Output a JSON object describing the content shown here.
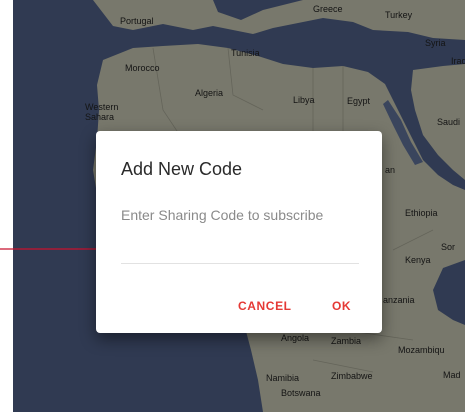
{
  "map": {
    "labels": {
      "portugal": "Portugal",
      "greece": "Greece",
      "turkey": "Turkey",
      "tunisia": "Tunisia",
      "syria": "Syria",
      "iraq": "Iraq",
      "morocco": "Morocco",
      "algeria": "Algeria",
      "libya": "Libya",
      "egypt": "Egypt",
      "western_sahara": "Western Sahara",
      "saudi": "Saudi",
      "sudan_fragment": "an",
      "ethiopia": "Ethiopia",
      "somalia_fragment": "Sor",
      "kenya": "Kenya",
      "tanzania": "anzania",
      "angola": "Angola",
      "zambia": "Zambia",
      "mozambique": "Mozambiqu",
      "namibia": "Namibia",
      "zimbabwe": "Zimbabwe",
      "madagascar": "Mad",
      "botswana": "Botswana"
    }
  },
  "dialog": {
    "title": "Add New Code",
    "input_placeholder": "Enter Sharing Code to subscribe",
    "input_value": "",
    "cancel_label": "CANCEL",
    "ok_label": "OK"
  },
  "colors": {
    "accent": "#e53935",
    "arrow": "#c8102e",
    "ocean": "#4a5a7e",
    "land": "#b9b9a6"
  }
}
